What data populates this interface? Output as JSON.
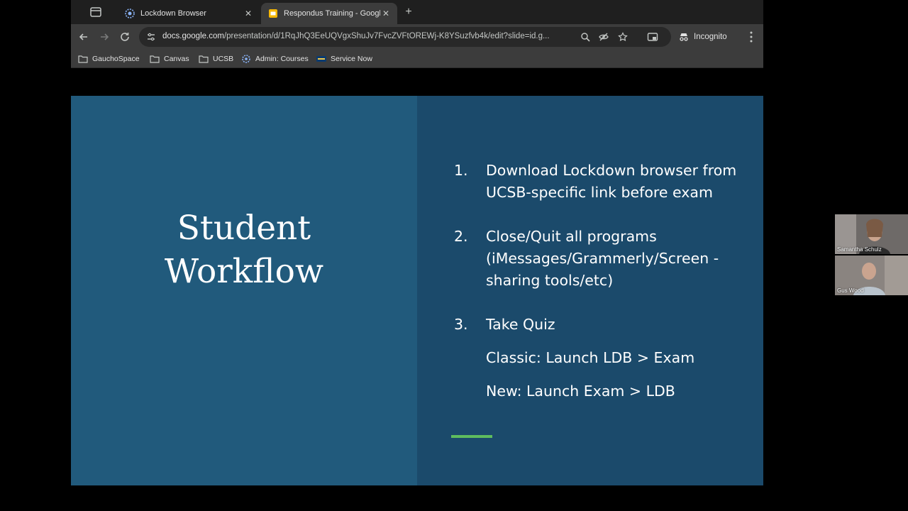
{
  "browser": {
    "tabs": [
      {
        "title": "Lockdown Browser",
        "active": false,
        "favicon": "respondus-icon"
      },
      {
        "title": "Respondus Training - Google Slides",
        "active": true,
        "favicon": "google-slides-icon"
      }
    ],
    "address": {
      "domain": "docs.google.com",
      "path": "/presentation/d/1RqJhQ3EeUQVgxShuJv7FvcZVFtOREWj-K8YSuzfvb4k/edit?slide=id.g..."
    },
    "incognito_label": "Incognito",
    "bookmarks": [
      {
        "label": "GauchoSpace",
        "icon": "folder-icon"
      },
      {
        "label": "Canvas",
        "icon": "folder-icon"
      },
      {
        "label": "UCSB",
        "icon": "folder-icon"
      },
      {
        "label": "Admin: Courses",
        "icon": "gear-icon"
      },
      {
        "label": "Service Now",
        "icon": "ucsb-logo-icon"
      }
    ]
  },
  "slide": {
    "title_line1": "Student",
    "title_line2": "Workflow",
    "steps": [
      {
        "num": "1.",
        "text": "Download Lockdown browser from UCSB-specific link before exam"
      },
      {
        "num": "2.",
        "text": "Close/Quit all programs (iMessages/Grammerly/Screen -sharing tools/etc)"
      },
      {
        "num": "3.",
        "text": "Take Quiz"
      }
    ],
    "sub_classic": "Classic: Launch LDB > Exam",
    "sub_new": "New: Launch Exam > LDB",
    "colors": {
      "left_panel": "#215a7c",
      "right_panel": "#1b4a6b",
      "accent": "#5ebd5e"
    }
  },
  "participants": [
    {
      "name": "Samantha Schulz"
    },
    {
      "name": "Gus Wood"
    }
  ]
}
